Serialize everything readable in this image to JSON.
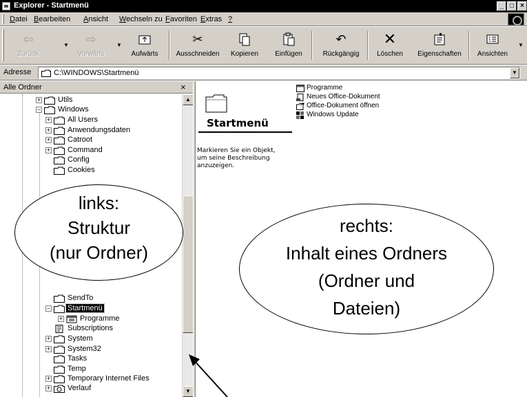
{
  "window": {
    "title": "Explorer - Startmenü"
  },
  "menu": [
    {
      "acc": "D",
      "rest": "atei"
    },
    {
      "acc": "B",
      "rest": "earbeiten"
    },
    {
      "acc": "A",
      "rest": "nsicht"
    },
    {
      "acc": "W",
      "rest": "echseln zu"
    },
    {
      "acc": "F",
      "rest": "avoriten"
    },
    {
      "acc": "E",
      "rest": "xtras"
    },
    {
      "acc": "?",
      "rest": ""
    }
  ],
  "toolbar": {
    "back": "Zurück",
    "forward": "Vorwärts",
    "up": "Aufwärts",
    "cut": "Ausschneiden",
    "copy": "Kopieren",
    "paste": "Einfügen",
    "undo": "Rückgängig",
    "delete": "Löschen",
    "properties": "Eigenschaften",
    "views": "Ansichten"
  },
  "address": {
    "label": "Adresse",
    "value": "C:\\WINDOWS\\Startmenü"
  },
  "left_pane": {
    "header": "Alle Ordner",
    "close": "×",
    "tree": [
      {
        "label": "Utils"
      },
      {
        "label": "Windows"
      },
      {
        "label": "All Users"
      },
      {
        "label": "Anwendungsdaten"
      },
      {
        "label": "Catroot"
      },
      {
        "label": "Command"
      },
      {
        "label": "Config"
      },
      {
        "label": "Cookies"
      },
      {
        "label": "SendTo"
      },
      {
        "label": "Startmenü"
      },
      {
        "label": "Programme"
      },
      {
        "label": "Subscriptions"
      },
      {
        "label": "System"
      },
      {
        "label": "System32"
      },
      {
        "label": "Tasks"
      },
      {
        "label": "Temp"
      },
      {
        "label": "Temporary Internet Files"
      },
      {
        "label": "Verlauf"
      }
    ]
  },
  "right_pane": {
    "folder_title": "Startmenü",
    "description": "Markieren Sie ein Objekt, um seine Beschreibung anzuzeigen.",
    "items": [
      {
        "label": "Programme"
      },
      {
        "label": "Neues Office-Dokument"
      },
      {
        "label": "Office-Dokument öffnen"
      },
      {
        "label": "Windows Update"
      }
    ]
  },
  "annotations": {
    "left": [
      "links:",
      "Struktur",
      "(nur Ordner)"
    ],
    "right": [
      "rechts:",
      "Inhalt eines Ordners",
      "(Ordner und",
      "Dateien)"
    ]
  },
  "colors": {
    "titlebar": "#000000",
    "chrome": "#d4d0c8",
    "folder": "#ffffff"
  }
}
